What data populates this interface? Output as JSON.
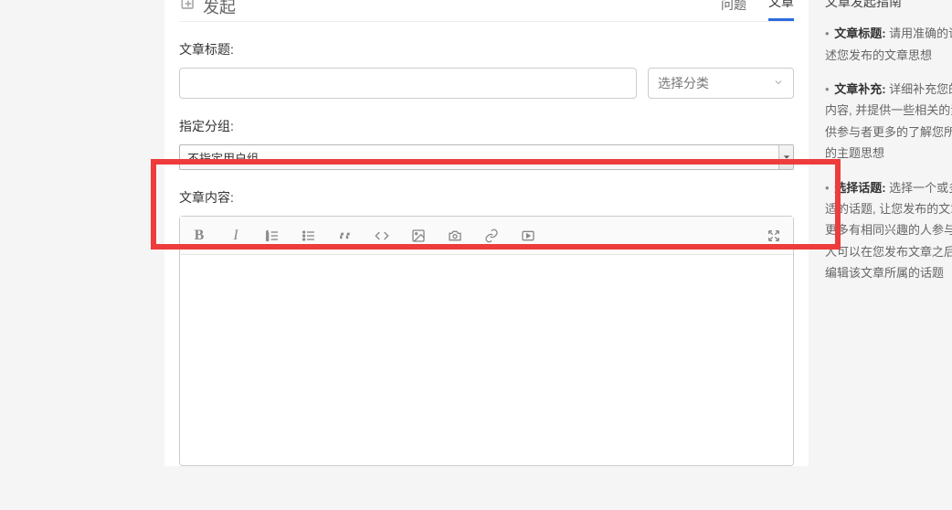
{
  "header": {
    "brand": "发起",
    "tabs": [
      {
        "label": "问题",
        "active": false
      },
      {
        "label": "文章",
        "active": true
      }
    ]
  },
  "fields": {
    "title_label": "文章标题:",
    "title_value": "",
    "category_placeholder": "选择分类",
    "group_label": "指定分组:",
    "group_selected": "不指定用户组",
    "content_label": "文章内容:"
  },
  "toolbar": {
    "bold": "B",
    "italic": "I"
  },
  "sidebar": {
    "title": "文章发起指南",
    "items": [
      {
        "label": "文章标题:",
        "text": "请用准确的语言描述您发布的文章思想"
      },
      {
        "label": "文章补充:",
        "text": "详细补充您的文章内容, 并提供一些相关的素材以供参与者更多的了解您所要表述的主题思想"
      },
      {
        "label": "选择话题:",
        "text": "选择一个或多个合适的话题, 让您发布的文章得到更多有相同兴趣的人参与. 所有人可以在您发布文章之后添加和编辑该文章所属的话题"
      }
    ]
  }
}
